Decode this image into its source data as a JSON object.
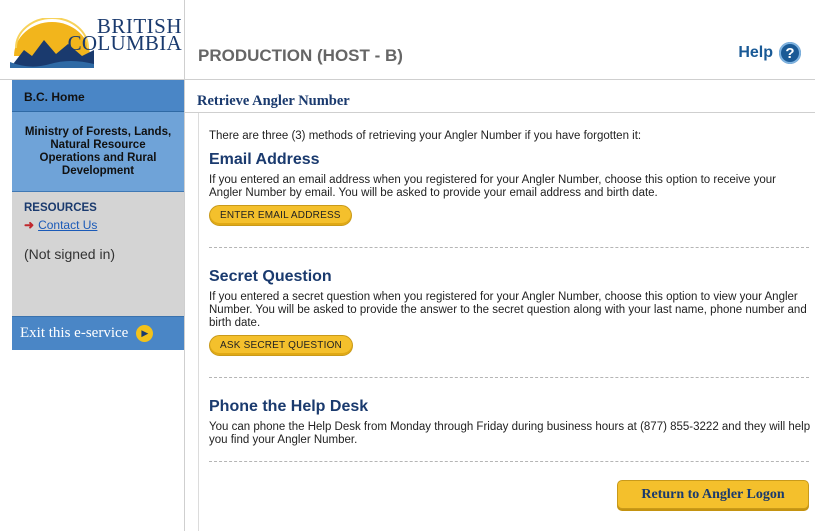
{
  "brand": {
    "line1": "BRITISH",
    "line2": "COLUMBIA"
  },
  "header": {
    "environment": "PRODUCTION (HOST - B)",
    "help_label": "Help",
    "help_icon": "question-icon"
  },
  "sidebar": {
    "home_label": "B.C. Home",
    "ministry": "Ministry of Forests, Lands, Natural Resource Operations and Rural Development",
    "resources_title": "RESOURCES",
    "contact_label": "Contact Us",
    "signed_status": "(Not signed in)",
    "exit_label": "Exit this e-service"
  },
  "main": {
    "title": "Retrieve Angler Number",
    "intro": "There are three (3) methods of retrieving your Angler Number if you have forgotten it:",
    "sections": [
      {
        "heading": "Email Address",
        "text": "If you entered an email address when you registered for your Angler Number, choose this option to receive your Angler Number by email. You will be asked to provide your email address and birth date.",
        "button": "ENTER EMAIL ADDRESS"
      },
      {
        "heading": "Secret Question",
        "text": "If you entered a secret question when you registered for your Angler Number, choose this option to view your Angler Number. You will be asked to provide the answer to the secret question along with your last name, phone number and birth date.",
        "button": "ASK SECRET QUESTION"
      },
      {
        "heading": "Phone the Help Desk",
        "text": "You can phone the Help Desk from Monday through Friday during business hours at (877) 855-3222 and they will help you find your Angler Number."
      }
    ],
    "return_button": "Return to Angler Logon"
  },
  "colors": {
    "brand_blue": "#1a3a6e",
    "accent_yellow": "#f4c02c",
    "sidebar_blue": "#4a86c6"
  }
}
